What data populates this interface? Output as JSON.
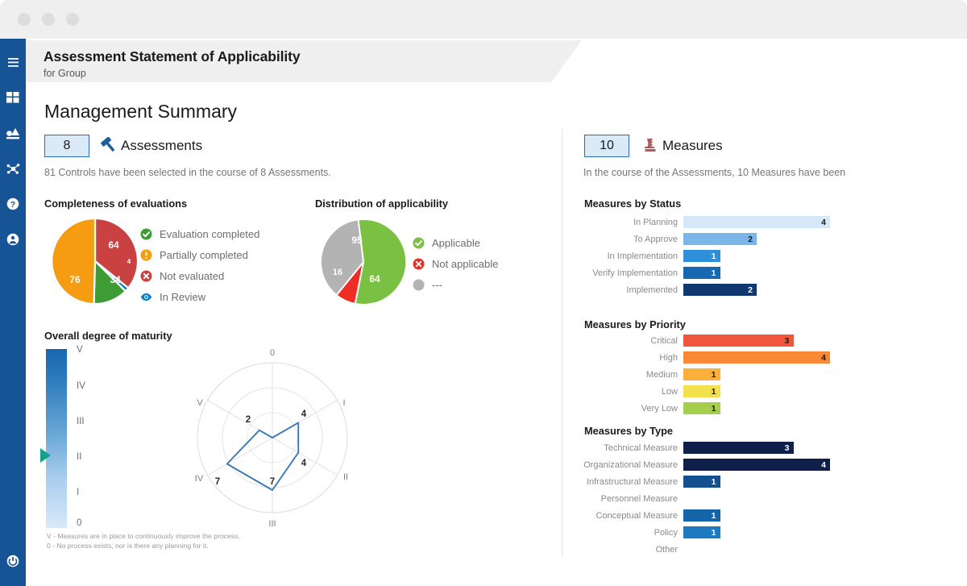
{
  "window": {
    "dots": [
      "minimize-dot",
      "maximize-dot",
      "close-dot"
    ]
  },
  "sidebar": {
    "items": [
      {
        "name": "menu",
        "icon": "hamburger-menu-icon"
      },
      {
        "name": "dashboard",
        "icon": "dashboard-grid-icon"
      },
      {
        "name": "reports",
        "icon": "shapes-chart-icon"
      },
      {
        "name": "network",
        "icon": "network-nodes-icon"
      },
      {
        "name": "help",
        "icon": "help-question-icon"
      },
      {
        "name": "account",
        "icon": "user-account-icon"
      }
    ],
    "bottom": {
      "name": "logout",
      "icon": "power-icon"
    }
  },
  "header": {
    "title": "Assessment Statement of Applicability",
    "subtitle": "for Group"
  },
  "page": {
    "title": "Management Summary"
  },
  "left": {
    "count": "8",
    "count_icon": "gavel-icon",
    "count_label": "Assessments",
    "lead": "81 Controls have been selected in the course of 8 Assessments.",
    "completeness_title": "Completeness of evaluations",
    "applicability_title": "Distribution of applicability",
    "maturity_title": "Overall degree of maturity",
    "maturity_note_line1": "V - Measures are in place to continuously improve the process.",
    "maturity_note_line2": "0 - No process exists, nor is there any planning for it.",
    "maturity_scale": [
      "V",
      "IV",
      "III",
      "II",
      "I",
      "0"
    ],
    "maturity_pointer_level": "II"
  },
  "right": {
    "count": "10",
    "count_icon": "measure-pawn-icon",
    "count_label": "Measures",
    "lead": "In the course of the Assessments, 10 Measures have been",
    "status_title": "Measures by Status",
    "priority_title": "Measures by Priority",
    "type_title": "Measures by Type"
  },
  "colors": {
    "sidebar": "#165496",
    "accent": "#2a6db0",
    "green": "#3f9c35",
    "orange": "#f59c13",
    "red": "#c94141",
    "blue": "#0a7cc4",
    "gray": "#b3b3b3",
    "teal": "#15a08c"
  },
  "chart_data": [
    {
      "type": "pie",
      "title": "Completeness of evaluations",
      "categories": [
        "Evaluation completed",
        "Partially completed",
        "Not evaluated",
        "In Review"
      ],
      "values": [
        34,
        76,
        64,
        4
      ],
      "colors": [
        "#3f9c35",
        "#f59c13",
        "#c94141",
        "#0a7cc4"
      ],
      "legend": [
        {
          "label": "Evaluation completed",
          "icon": "check-circle-icon",
          "color": "#3f9c35"
        },
        {
          "label": "Partially completed",
          "icon": "exclamation-circle-icon",
          "color": "#f59c13"
        },
        {
          "label": "Not evaluated",
          "icon": "x-circle-icon",
          "color": "#c94141"
        },
        {
          "label": "In Review",
          "icon": "eye-icon",
          "color": "#0a7cc4"
        }
      ],
      "legend_position": "right",
      "data_labels": true
    },
    {
      "type": "pie",
      "title": "Distribution of applicability",
      "categories": [
        "Applicable",
        "Not applicable",
        "---"
      ],
      "values": [
        95,
        16,
        64
      ],
      "colors": [
        "#7ac143",
        "#ee2e24",
        "#b3b3b3"
      ],
      "legend": [
        {
          "label": "Applicable",
          "icon": "check-circle-icon",
          "color": "#7ac143"
        },
        {
          "label": "Not applicable",
          "icon": "x-circle-icon",
          "color": "#ee2e24"
        },
        {
          "label": "---",
          "icon": "gray-dot-icon",
          "color": "#b3b3b3"
        }
      ],
      "legend_position": "right",
      "data_labels": true
    },
    {
      "type": "line",
      "subtype": "radar",
      "title": "Overall degree of maturity",
      "categories": [
        "0",
        "I",
        "II",
        "III",
        "IV",
        "V"
      ],
      "values": [
        null,
        4,
        4,
        7,
        7,
        2
      ],
      "point_labels": [
        "",
        "4",
        "4",
        "7",
        "7",
        "2"
      ],
      "ylim": [
        0,
        10
      ],
      "grid": true,
      "line_color": "#3d7ab5"
    },
    {
      "type": "bar",
      "orientation": "horizontal",
      "title": "Measures by Status",
      "categories": [
        "In Planning",
        "To Approve",
        "In Implementation",
        "Verify Implementation",
        "Implemented"
      ],
      "values": [
        4,
        2,
        1,
        1,
        2
      ],
      "colors": [
        "#d6e7f7",
        "#7cb6e8",
        "#2f8fd8",
        "#1668b3",
        "#10386e"
      ],
      "label_colors": [
        "#1a1a1a",
        "#1a1a1a",
        "#ffffff",
        "#ffffff",
        "#ffffff"
      ],
      "xlim": [
        0,
        4
      ],
      "grid": false
    },
    {
      "type": "bar",
      "orientation": "horizontal",
      "title": "Measures by Priority",
      "categories": [
        "Critical",
        "High",
        "Medium",
        "Low",
        "Very Low"
      ],
      "values": [
        3,
        4,
        1,
        1,
        1
      ],
      "colors": [
        "#f0563c",
        "#f98936",
        "#fbb03b",
        "#f2e14c",
        "#a5cd4e"
      ],
      "label_colors": [
        "#1a1a1a",
        "#1a1a1a",
        "#1a1a1a",
        "#1a1a1a",
        "#1a1a1a"
      ],
      "xlim": [
        0,
        4
      ],
      "grid": false
    },
    {
      "type": "bar",
      "orientation": "horizontal",
      "title": "Measures by Type",
      "categories": [
        "Technical Measure",
        "Organizational Measure",
        "Infrastructural Measure",
        "Personnel Measure",
        "Conceptual Measure",
        "Policy",
        "Other"
      ],
      "values": [
        3,
        4,
        1,
        0,
        1,
        1,
        0
      ],
      "colors": [
        "#0e1f4a",
        "#0e1f4a",
        "#12508f",
        "#12508f",
        "#1464a8",
        "#1d7ac0",
        "#1d7ac0"
      ],
      "label_colors": [
        "#ffffff",
        "#ffffff",
        "#ffffff",
        "#ffffff",
        "#ffffff",
        "#ffffff",
        "#ffffff"
      ],
      "xlim": [
        0,
        4
      ],
      "grid": false
    }
  ]
}
